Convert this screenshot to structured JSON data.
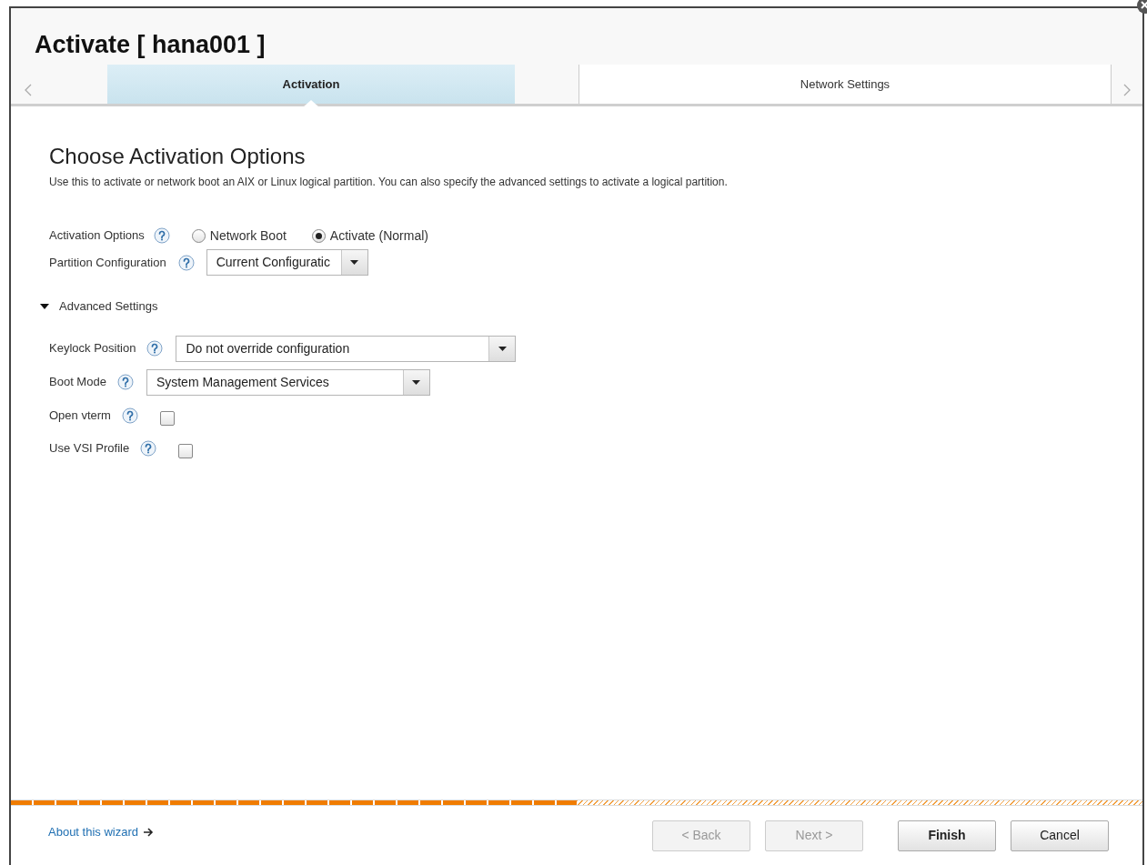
{
  "window": {
    "title": "Activate [ hana001 ]"
  },
  "tabs": [
    {
      "label": "Activation",
      "selected": true
    },
    {
      "label": "Network Settings",
      "selected": false
    }
  ],
  "heading": "Choose Activation Options",
  "description": "Use this to activate or network boot an AIX or Linux logical partition. You can also specify the advanced settings to activate a logical partition.",
  "activation_options": {
    "label": "Activation Options",
    "options": [
      {
        "label": "Network Boot",
        "selected": false
      },
      {
        "label": "Activate (Normal)",
        "selected": true
      }
    ]
  },
  "partition_configuration": {
    "label": "Partition Configuration",
    "value": "Current Configuratic"
  },
  "advanced_settings": {
    "label": "Advanced Settings",
    "expanded": true,
    "fields": [
      {
        "kind": "select",
        "label": "Keylock Position",
        "value": "Do not override configuration"
      },
      {
        "kind": "select",
        "label": "Boot Mode",
        "value": "System Management Services"
      },
      {
        "kind": "checkbox",
        "label": "Open vterm",
        "checked": false
      },
      {
        "kind": "checkbox",
        "label": "Use VSI Profile",
        "checked": false
      }
    ]
  },
  "progress": {
    "level": 0.5
  },
  "footer": {
    "link": "About this wizard",
    "buttons": [
      {
        "label": "< Back",
        "disabled": true,
        "primary": false
      },
      {
        "label": "Next >",
        "disabled": true,
        "primary": false
      },
      {
        "label": "Finish",
        "disabled": false,
        "primary": true
      },
      {
        "label": "Cancel",
        "disabled": false,
        "primary": false
      }
    ]
  }
}
